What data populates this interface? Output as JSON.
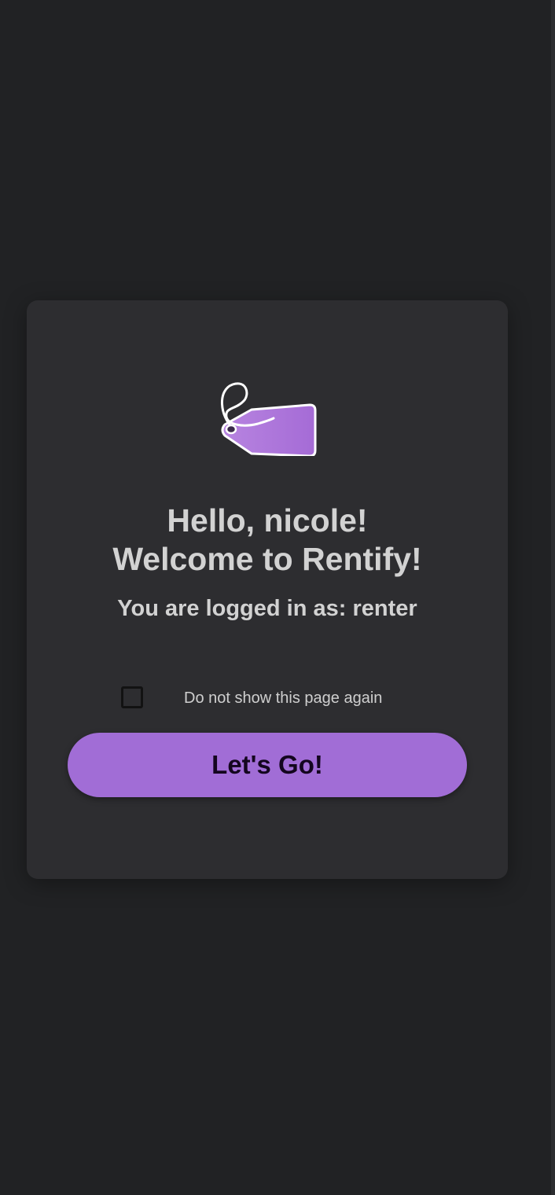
{
  "app": {
    "name": "Rentify",
    "brand_color": "#a16dd6",
    "logo_icon": "price-tag-icon"
  },
  "welcome": {
    "greeting_line": "Hello, nicole!",
    "welcome_line": "Welcome to Rentify!",
    "role_text": "You are logged in as: renter"
  },
  "options": {
    "dont_show_again_label": "Do not show this page again",
    "dont_show_again_checked": false
  },
  "actions": {
    "go_label": "Let's Go!"
  }
}
